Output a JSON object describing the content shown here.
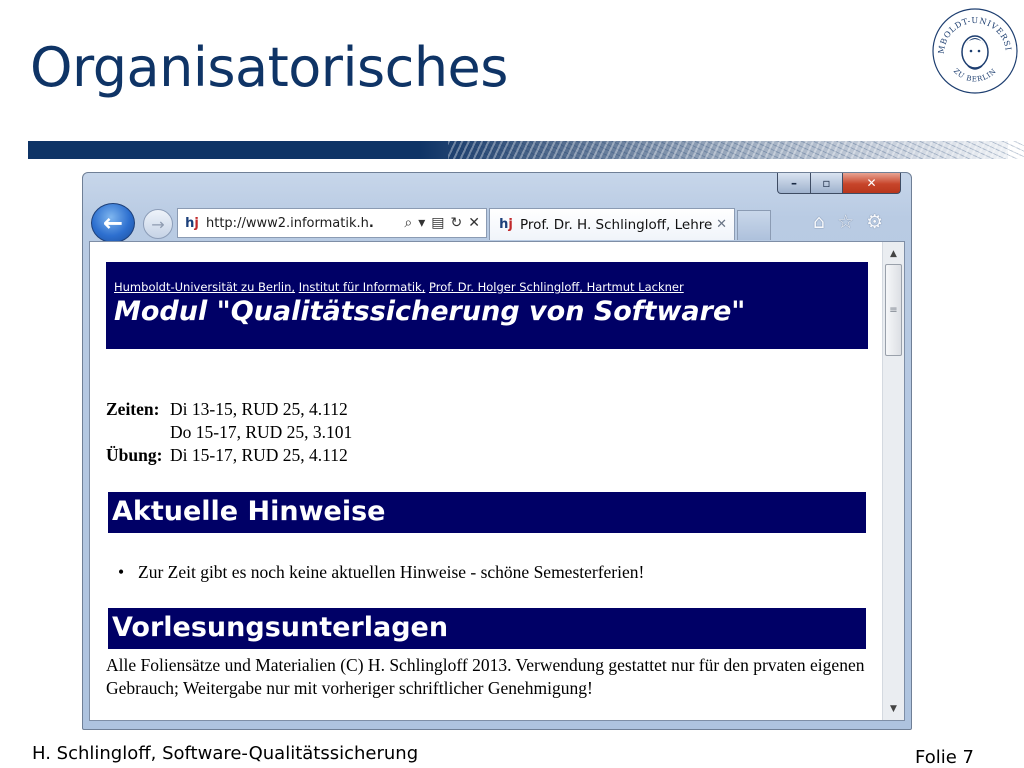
{
  "slide": {
    "title": "Organisatorisches",
    "footer_left": "H. Schlingloff, Software-Qualitätssicherung",
    "footer_right": "Folie 7",
    "seal_text_top": "HUMBOLDT-UNIVERSITÄT",
    "seal_text_bottom": "ZU BERLIN"
  },
  "browser": {
    "window_controls": {
      "minimize": "–",
      "maximize": "▫",
      "close": "✕"
    },
    "address": "http://www2.informatik.h",
    "address_suffix": ".",
    "tab_title": "Prof. Dr. H. Schlingloff, Lehre",
    "tab_close": "✕",
    "icons": [
      "back-icon",
      "forward-icon",
      "search-icon",
      "dropdown-icon",
      "compat-icon",
      "refresh-icon",
      "stop-icon",
      "home-icon",
      "favorites-icon",
      "settings-icon"
    ]
  },
  "page": {
    "breadcrumb": [
      "Humboldt-Universität zu Berlin,",
      "Institut für Informatik,",
      "Prof. Dr. Holger Schlingloff, Hartmut Lackner"
    ],
    "module_title": "Modul \"Qualitätssicherung von Software\"",
    "times": [
      {
        "label": "Zeiten:",
        "value": "Di 13-15, RUD 25, 4.112"
      },
      {
        "label": "",
        "value": "Do 15-17, RUD 25, 3.101"
      },
      {
        "label": "Übung:",
        "value": "Di 15-17, RUD 25, 4.112"
      }
    ],
    "section1_title": "Aktuelle Hinweise",
    "section1_item": "Zur Zeit gibt es noch keine aktuellen Hinweise - schöne Semesterferien!",
    "section2_title": "Vorlesungsunterlagen",
    "section2_text": "Alle Foliensätze und Materialien (C) H. Schlingloff 2013. Verwendung gestattet nur für den prvaten eigenen Gebrauch; Weitergabe nur mit vorheriger schriftlicher Genehmigung!"
  },
  "colors": {
    "slide_title": "#0f3466",
    "banner": "#000066"
  }
}
